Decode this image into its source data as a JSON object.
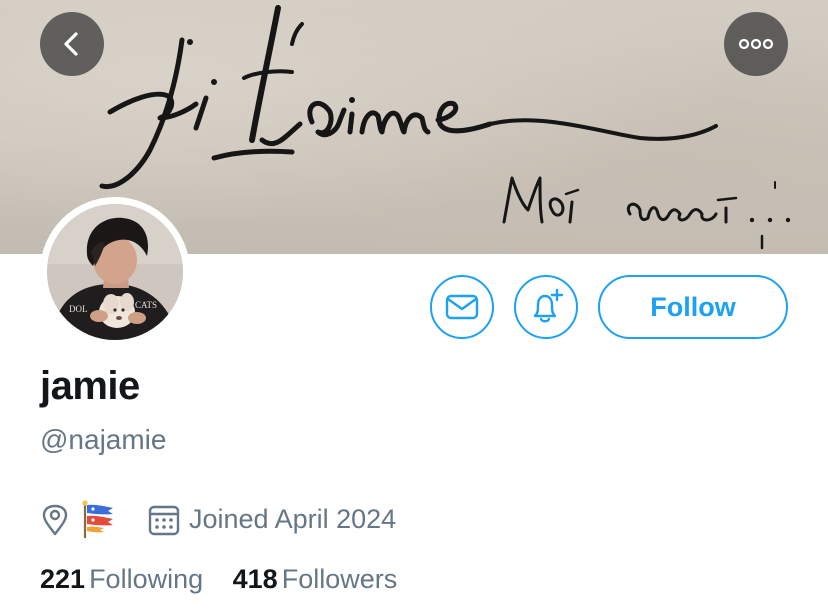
{
  "banner": {
    "handwriting_main": "je t'aime",
    "handwriting_reply": "Moi aussi..."
  },
  "navigation": {
    "back_icon": "chevron-left-icon",
    "more_icon": "ellipsis-icon"
  },
  "profile": {
    "display_name": "jamie",
    "handle": "@najamie",
    "location_flag": "🎏",
    "joined": "Joined April 2024",
    "avatar_shirt_text": "CATS"
  },
  "actions": {
    "message_icon": "envelope-icon",
    "notify_icon": "bell-plus-icon",
    "follow_label": "Follow"
  },
  "stats": {
    "following_count": "221",
    "following_label": "Following",
    "followers_count": "418",
    "followers_label": "Followers"
  },
  "colors": {
    "accent": "#1da1f2",
    "secondary_text": "#657786",
    "primary_text": "#14171a"
  }
}
